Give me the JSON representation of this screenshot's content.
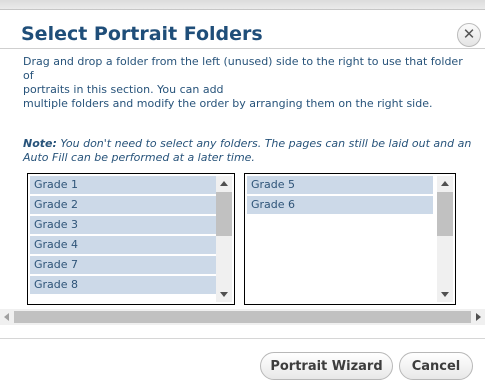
{
  "dialog": {
    "title": "Select Portrait Folders",
    "close_glyph": "✕",
    "instructions": "Drag and drop a folder from the left (unused) side to the right to use that folder of portraits in this section. You can add multiple folders and modify the order by arranging them on the right side.",
    "instructions_line1": "Drag and drop a folder from the left (unused) side to the right to use that folder of",
    "instructions_line2": "portraits in this section. You can add",
    "instructions_line3": "multiple folders and modify the order by arranging them on the right side.",
    "note_label": "Note:",
    "note_text": " You don't need to select any folders. The pages can still be laid out and an Auto Fill can be performed at a later time."
  },
  "unused_folders": [
    "Grade 1",
    "Grade 2",
    "Grade 3",
    "Grade 4",
    "Grade 7",
    "Grade 8"
  ],
  "used_folders": [
    "Grade 5",
    "Grade 6"
  ],
  "buttons": {
    "wizard_label": "Portrait Wizard",
    "cancel_label": "Cancel"
  },
  "colors": {
    "title": "#1f4e79",
    "text": "#27537a",
    "item_bg": "#ccd9e8"
  },
  "icons": {
    "close": "close-icon",
    "scroll_up": "chevron-up-icon",
    "scroll_down": "chevron-down-icon",
    "scroll_left": "chevron-left-icon",
    "scroll_right": "chevron-right-icon"
  }
}
